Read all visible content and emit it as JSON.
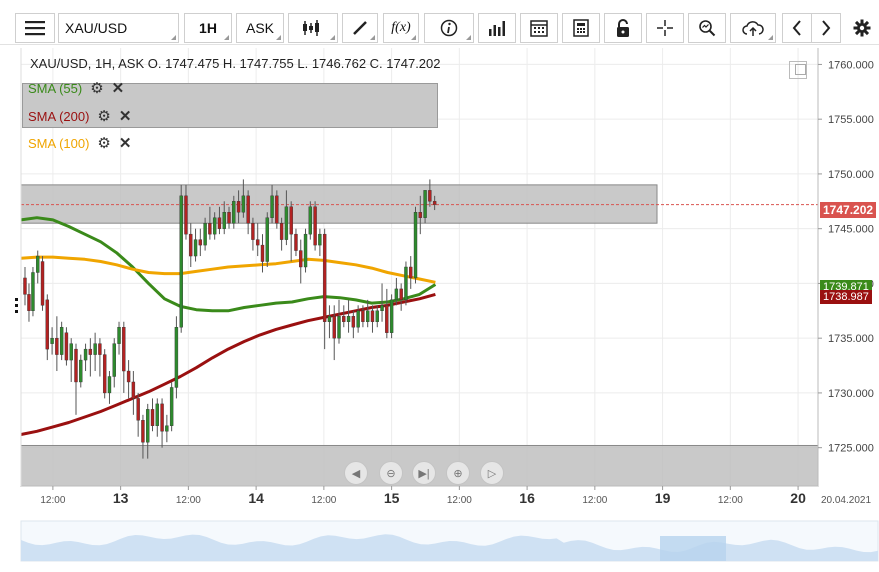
{
  "toolbar": {
    "symbol": "XAU/USD",
    "timeframe": "1H",
    "price_side": "ASK",
    "icons": [
      "menu-icon",
      "candlestick-icon",
      "draw-icon",
      "function-icon",
      "info-icon",
      "bar-chart-icon",
      "calendar-icon",
      "calculator-icon",
      "lock-icon",
      "crosshair-icon",
      "zoom-icon",
      "cloud-upload-icon",
      "prev-icon",
      "next-icon",
      "settings-icon"
    ],
    "function_label": "f(x)"
  },
  "header": {
    "ohlc_text": "XAU/USD, 1H, ASK   O. 1747.475 H. 1747.755 L. 1746.762 C. 1747.202"
  },
  "indicators": [
    {
      "label": "SMA (55)",
      "color": "#3a8a1a"
    },
    {
      "label": "SMA (200)",
      "color": "#9a1010"
    },
    {
      "label": "SMA (100)",
      "color": "#f0a500"
    }
  ],
  "price_tags": {
    "last": "1747.202",
    "sma55": "1739.871",
    "sma200": "1738.987"
  },
  "colors": {
    "last_tag": "#d9534f",
    "sma55_tag": "#3a8a1a",
    "sma200_tag": "#9a1010",
    "zone_fill": "#c0c0c0",
    "candle_up": "#2e8a2e",
    "candle_down": "#b22222"
  },
  "navigation": [
    "prev-icon",
    "zoom-out-icon",
    "reset-icon",
    "zoom-in-icon",
    "play-icon"
  ],
  "chart_data": {
    "type": "candlestick",
    "symbol": "XAU/USD",
    "ylim": [
      1721.5,
      1761.5
    ],
    "xlim": [
      0,
      100
    ],
    "yticks": [
      1760.0,
      1755.0,
      1750.0,
      1745.0,
      1740.0,
      1735.0,
      1730.0,
      1725.0
    ],
    "ytick_labels": [
      "1760.000",
      "1755.000",
      "1750.000",
      "1745.000",
      "1740.000",
      "1735.000",
      "1730.000",
      "1725.000"
    ],
    "xticks": [
      {
        "x": 4,
        "label": "12:00",
        "bold": false
      },
      {
        "x": 12.5,
        "label": "13",
        "bold": true
      },
      {
        "x": 21,
        "label": "12:00",
        "bold": false
      },
      {
        "x": 29.5,
        "label": "14",
        "bold": true
      },
      {
        "x": 38,
        "label": "12:00",
        "bold": false
      },
      {
        "x": 46.5,
        "label": "15",
        "bold": true
      },
      {
        "x": 55,
        "label": "12:00",
        "bold": false
      },
      {
        "x": 63.5,
        "label": "16",
        "bold": true
      },
      {
        "x": 72,
        "label": "12:00",
        "bold": false
      },
      {
        "x": 80.5,
        "label": "19",
        "bold": true
      },
      {
        "x": 89,
        "label": "12:00",
        "bold": false
      },
      {
        "x": 97.5,
        "label": "20",
        "bold": true
      }
    ],
    "end_date_label": "20.04.2021",
    "zones": [
      {
        "from": 1745.5,
        "to": 1749.0,
        "x_end": 79.8
      },
      {
        "from": 1721.5,
        "to": 1725.2,
        "x_end": 100
      }
    ],
    "last_price_line": 1747.202,
    "candles": [
      [
        0.5,
        1740.5,
        1739.0,
        1741.5,
        1738.0
      ],
      [
        1.0,
        1739.0,
        1737.5,
        1740.0,
        1736.5
      ],
      [
        1.5,
        1737.5,
        1741.0,
        1741.5,
        1737.0
      ],
      [
        2.1,
        1741.0,
        1742.5,
        1743.0,
        1740.0
      ],
      [
        2.7,
        1742.0,
        1738.0,
        1742.5,
        1737.5
      ],
      [
        3.3,
        1738.5,
        1734.0,
        1739.0,
        1733.0
      ],
      [
        3.9,
        1734.5,
        1735.0,
        1736.0,
        1733.5
      ],
      [
        4.5,
        1735.0,
        1733.5,
        1737.0,
        1732.0
      ],
      [
        5.1,
        1733.5,
        1736.0,
        1736.5,
        1733.0
      ],
      [
        5.7,
        1735.5,
        1733.0,
        1736.0,
        1732.5
      ],
      [
        6.3,
        1733.0,
        1734.5,
        1735.0,
        1731.0
      ],
      [
        6.9,
        1734.0,
        1731.0,
        1734.5,
        1728.0
      ],
      [
        7.5,
        1731.0,
        1733.0,
        1733.5,
        1730.5
      ],
      [
        8.1,
        1733.0,
        1734.0,
        1734.5,
        1732.0
      ],
      [
        8.7,
        1734.0,
        1733.5,
        1735.0,
        1731.5
      ],
      [
        9.3,
        1733.5,
        1734.5,
        1735.5,
        1732.0
      ],
      [
        9.9,
        1734.5,
        1733.5,
        1735.0,
        1731.5
      ],
      [
        10.5,
        1733.5,
        1730.0,
        1734.0,
        1729.5
      ],
      [
        11.1,
        1730.0,
        1731.5,
        1732.0,
        1729.0
      ],
      [
        11.7,
        1731.5,
        1734.5,
        1735.0,
        1730.5
      ],
      [
        12.3,
        1734.5,
        1736.0,
        1736.5,
        1733.5
      ],
      [
        12.9,
        1736.0,
        1732.0,
        1736.5,
        1730.0
      ],
      [
        13.5,
        1732.0,
        1731.0,
        1733.0,
        1729.5
      ],
      [
        14.1,
        1731.0,
        1729.5,
        1732.0,
        1728.0
      ],
      [
        14.7,
        1729.5,
        1727.5,
        1730.0,
        1726.0
      ],
      [
        15.3,
        1727.5,
        1725.5,
        1728.0,
        1724.0
      ],
      [
        15.9,
        1725.5,
        1728.5,
        1729.0,
        1724.0
      ],
      [
        16.5,
        1728.5,
        1727.0,
        1729.5,
        1726.5
      ],
      [
        17.1,
        1727.0,
        1729.0,
        1729.5,
        1726.0
      ],
      [
        17.7,
        1729.0,
        1726.5,
        1729.5,
        1725.0
      ],
      [
        18.3,
        1726.5,
        1727.0,
        1728.0,
        1725.5
      ],
      [
        18.9,
        1727.0,
        1730.5,
        1731.0,
        1726.5
      ],
      [
        19.5,
        1730.5,
        1736.0,
        1737.0,
        1729.5
      ],
      [
        20.1,
        1736.0,
        1748.0,
        1749.0,
        1735.5
      ],
      [
        20.7,
        1748.0,
        1744.5,
        1749.0,
        1744.0
      ],
      [
        21.3,
        1744.5,
        1742.5,
        1745.5,
        1741.5
      ],
      [
        21.9,
        1742.5,
        1744.0,
        1745.0,
        1742.0
      ],
      [
        22.5,
        1744.0,
        1743.5,
        1745.0,
        1742.5
      ],
      [
        23.1,
        1743.5,
        1745.5,
        1746.0,
        1743.0
      ],
      [
        23.7,
        1745.5,
        1744.5,
        1747.0,
        1744.0
      ],
      [
        24.3,
        1744.5,
        1746.0,
        1746.5,
        1744.0
      ],
      [
        24.9,
        1746.0,
        1745.0,
        1747.0,
        1744.5
      ],
      [
        25.5,
        1745.0,
        1746.5,
        1747.5,
        1744.5
      ],
      [
        26.1,
        1746.5,
        1745.5,
        1747.0,
        1745.0
      ],
      [
        26.7,
        1745.5,
        1747.5,
        1748.0,
        1745.0
      ],
      [
        27.3,
        1747.5,
        1746.5,
        1748.5,
        1745.5
      ],
      [
        27.9,
        1746.5,
        1748.0,
        1749.5,
        1746.0
      ],
      [
        28.5,
        1748.0,
        1745.5,
        1748.5,
        1744.5
      ],
      [
        29.1,
        1745.5,
        1744.0,
        1746.0,
        1743.0
      ],
      [
        29.7,
        1744.0,
        1743.5,
        1745.5,
        1742.5
      ],
      [
        30.3,
        1743.5,
        1742.0,
        1744.5,
        1741.0
      ],
      [
        30.9,
        1742.0,
        1746.0,
        1746.5,
        1741.5
      ],
      [
        31.5,
        1746.0,
        1748.0,
        1749.0,
        1745.5
      ],
      [
        32.1,
        1748.0,
        1745.5,
        1748.5,
        1745.0
      ],
      [
        32.7,
        1745.5,
        1744.0,
        1746.0,
        1743.0
      ],
      [
        33.3,
        1744.0,
        1747.0,
        1748.5,
        1743.5
      ],
      [
        33.9,
        1747.0,
        1744.5,
        1747.5,
        1742.0
      ],
      [
        34.5,
        1744.5,
        1743.0,
        1745.0,
        1742.5
      ],
      [
        35.1,
        1743.0,
        1741.5,
        1744.0,
        1740.0
      ],
      [
        35.7,
        1741.5,
        1744.5,
        1745.0,
        1741.0
      ],
      [
        36.3,
        1744.5,
        1747.0,
        1747.5,
        1744.0
      ],
      [
        36.9,
        1747.0,
        1743.5,
        1747.5,
        1743.0
      ],
      [
        37.5,
        1743.5,
        1744.5,
        1745.0,
        1742.5
      ],
      [
        38.1,
        1744.5,
        1736.5,
        1745.0,
        1734.0
      ],
      [
        38.7,
        1736.5,
        1737.0,
        1738.0,
        1735.0
      ],
      [
        39.3,
        1737.0,
        1735.0,
        1738.0,
        1733.0
      ],
      [
        39.9,
        1735.0,
        1737.0,
        1738.5,
        1734.5
      ],
      [
        40.5,
        1737.0,
        1736.5,
        1738.0,
        1736.0
      ],
      [
        41.1,
        1736.5,
        1737.0,
        1738.5,
        1735.5
      ],
      [
        41.7,
        1737.0,
        1736.0,
        1737.5,
        1735.0
      ],
      [
        42.3,
        1736.0,
        1737.5,
        1738.0,
        1735.5
      ],
      [
        42.9,
        1737.5,
        1736.5,
        1738.0,
        1736.0
      ],
      [
        43.5,
        1736.5,
        1737.5,
        1738.5,
        1736.0
      ],
      [
        44.1,
        1737.5,
        1736.5,
        1738.0,
        1735.5
      ],
      [
        44.7,
        1736.5,
        1737.5,
        1738.0,
        1736.0
      ],
      [
        45.3,
        1737.5,
        1738.0,
        1740.0,
        1736.5
      ],
      [
        45.9,
        1738.0,
        1735.5,
        1739.5,
        1735.0
      ],
      [
        46.5,
        1735.5,
        1738.5,
        1739.0,
        1735.0
      ],
      [
        47.1,
        1738.5,
        1739.5,
        1740.5,
        1738.0
      ],
      [
        47.7,
        1739.5,
        1738.5,
        1740.0,
        1737.5
      ],
      [
        48.3,
        1738.5,
        1741.5,
        1742.0,
        1738.0
      ],
      [
        48.9,
        1741.5,
        1740.5,
        1742.5,
        1739.5
      ],
      [
        49.5,
        1740.5,
        1746.5,
        1747.0,
        1740.0
      ],
      [
        50.1,
        1746.5,
        1746.0,
        1748.0,
        1744.5
      ],
      [
        50.7,
        1746.0,
        1748.5,
        1748.5,
        1745.5
      ],
      [
        51.3,
        1748.5,
        1747.5,
        1749.5,
        1747.0
      ],
      [
        51.9,
        1747.5,
        1747.2,
        1748.0,
        1746.7
      ]
    ],
    "series": [
      {
        "name": "SMA (55)",
        "color": "#3a8a1a",
        "points": [
          [
            0,
            1745.8
          ],
          [
            2,
            1746.0
          ],
          [
            4,
            1745.8
          ],
          [
            6,
            1745.2
          ],
          [
            8,
            1744.5
          ],
          [
            10,
            1743.8
          ],
          [
            12,
            1742.8
          ],
          [
            14,
            1741.5
          ],
          [
            16,
            1740.0
          ],
          [
            18,
            1738.6
          ],
          [
            20,
            1737.9
          ],
          [
            22,
            1737.6
          ],
          [
            24,
            1737.5
          ],
          [
            26,
            1737.5
          ],
          [
            28,
            1737.8
          ],
          [
            30,
            1738.0
          ],
          [
            32,
            1738.2
          ],
          [
            34,
            1738.3
          ],
          [
            36,
            1738.6
          ],
          [
            38,
            1738.8
          ],
          [
            40,
            1738.7
          ],
          [
            42,
            1738.5
          ],
          [
            44,
            1738.2
          ],
          [
            46,
            1738.3
          ],
          [
            48,
            1738.6
          ],
          [
            50,
            1739.0
          ],
          [
            52,
            1739.9
          ]
        ]
      },
      {
        "name": "SMA (200)",
        "color": "#9a1010",
        "points": [
          [
            0,
            1726.2
          ],
          [
            2,
            1726.5
          ],
          [
            4,
            1726.9
          ],
          [
            6,
            1727.3
          ],
          [
            8,
            1727.8
          ],
          [
            10,
            1728.3
          ],
          [
            12,
            1728.9
          ],
          [
            14,
            1729.5
          ],
          [
            16,
            1730.1
          ],
          [
            18,
            1730.8
          ],
          [
            20,
            1731.5
          ],
          [
            22,
            1732.3
          ],
          [
            24,
            1733.2
          ],
          [
            26,
            1734.0
          ],
          [
            28,
            1734.7
          ],
          [
            30,
            1735.3
          ],
          [
            32,
            1735.8
          ],
          [
            34,
            1736.2
          ],
          [
            36,
            1736.6
          ],
          [
            38,
            1736.9
          ],
          [
            40,
            1737.2
          ],
          [
            42,
            1737.5
          ],
          [
            44,
            1737.8
          ],
          [
            46,
            1738.0
          ],
          [
            48,
            1738.3
          ],
          [
            50,
            1738.6
          ],
          [
            52,
            1739.0
          ]
        ]
      },
      {
        "name": "SMA (100)",
        "color": "#f0a500",
        "points": [
          [
            0,
            1742.3
          ],
          [
            2,
            1742.4
          ],
          [
            4,
            1742.4
          ],
          [
            6,
            1742.3
          ],
          [
            8,
            1742.2
          ],
          [
            10,
            1742.0
          ],
          [
            12,
            1741.7
          ],
          [
            14,
            1741.3
          ],
          [
            16,
            1741.0
          ],
          [
            18,
            1740.9
          ],
          [
            20,
            1740.9
          ],
          [
            22,
            1741.1
          ],
          [
            24,
            1741.3
          ],
          [
            26,
            1741.5
          ],
          [
            28,
            1741.6
          ],
          [
            30,
            1741.7
          ],
          [
            32,
            1741.8
          ],
          [
            34,
            1742.0
          ],
          [
            36,
            1742.2
          ],
          [
            38,
            1742.1
          ],
          [
            40,
            1741.9
          ],
          [
            42,
            1741.7
          ],
          [
            44,
            1741.4
          ],
          [
            46,
            1741.0
          ],
          [
            48,
            1740.7
          ],
          [
            50,
            1740.4
          ],
          [
            52,
            1740.1
          ]
        ]
      }
    ]
  }
}
